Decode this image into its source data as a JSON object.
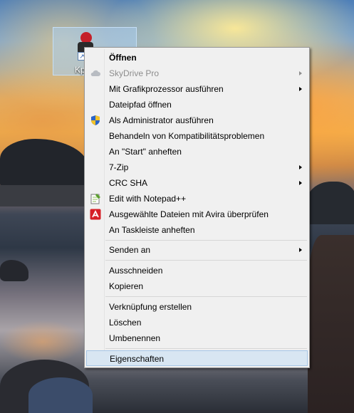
{
  "desktop": {
    "icon_label": "Kp"
  },
  "menu": {
    "items": [
      {
        "label": "Öffnen",
        "bold": true,
        "icon": ""
      },
      {
        "label": "SkyDrive Pro",
        "disabled": true,
        "submenu": true,
        "icon": "cloud-icon"
      },
      {
        "label": "Mit Grafikprozessor ausführen",
        "submenu": true,
        "icon": ""
      },
      {
        "label": "Dateipfad öffnen",
        "icon": ""
      },
      {
        "label": "Als Administrator ausführen",
        "icon": "uac-shield-icon"
      },
      {
        "label": "Behandeln von Kompatibilitätsproblemen",
        "icon": ""
      },
      {
        "label": "An \"Start\" anheften",
        "icon": ""
      },
      {
        "label": "7-Zip",
        "submenu": true,
        "icon": ""
      },
      {
        "label": "CRC SHA",
        "submenu": true,
        "icon": ""
      },
      {
        "label": "Edit with Notepad++",
        "icon": "notepad-plus-plus-icon"
      },
      {
        "label": "Ausgewählte Dateien mit Avira überprüfen",
        "icon": "avira-icon"
      },
      {
        "label": "An Taskleiste anheften",
        "icon": ""
      },
      {
        "label": "Senden an",
        "submenu": true,
        "icon": ""
      },
      {
        "label": "Ausschneiden",
        "icon": ""
      },
      {
        "label": "Kopieren",
        "icon": ""
      },
      {
        "label": "Verknüpfung erstellen",
        "icon": ""
      },
      {
        "label": "Löschen",
        "icon": ""
      },
      {
        "label": "Umbenennen",
        "icon": ""
      },
      {
        "label": "Eigenschaften",
        "highlighted": true,
        "icon": ""
      }
    ]
  },
  "colors": {
    "menu_background": "#f0f0f0",
    "highlight_background": "#d8e6f2",
    "highlight_border": "#a6c6e6",
    "disabled_text": "#8d8d8d",
    "avira_red": "#d61f26"
  }
}
